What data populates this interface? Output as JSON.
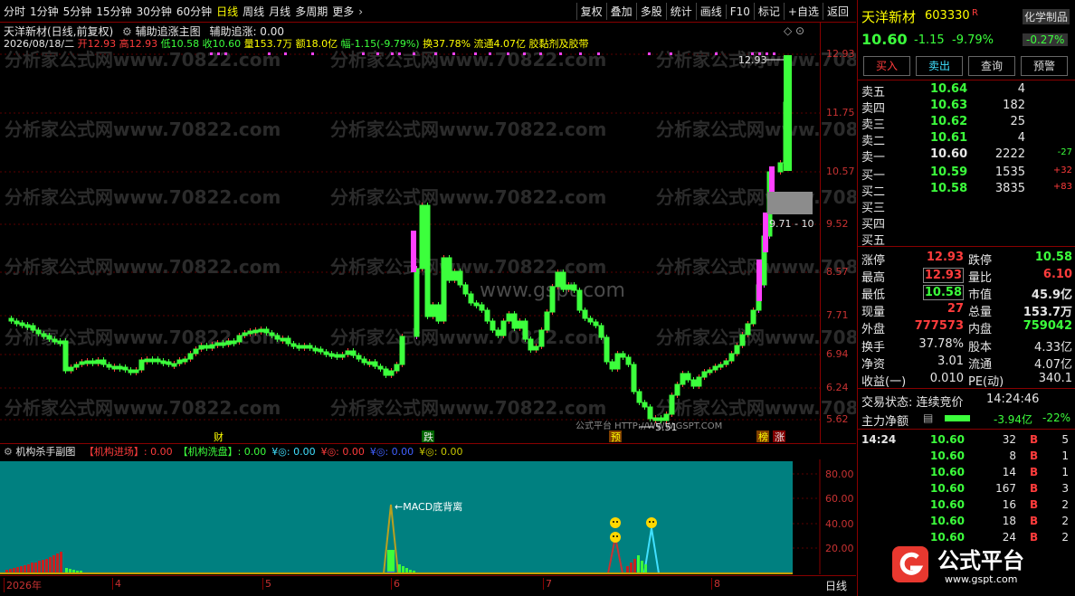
{
  "toolbar": {
    "periods": [
      "分时",
      "1分钟",
      "5分钟",
      "15分钟",
      "30分钟",
      "60分钟",
      "日线",
      "周线",
      "月线",
      "多周期",
      "更多"
    ],
    "active": "日线",
    "right": [
      "复权",
      "叠加",
      "多股",
      "统计",
      "画线",
      "F10",
      "标记",
      "+自选",
      "返回"
    ]
  },
  "header": {
    "title": "天洋新材(日线,前复权)",
    "indicator": "辅助追涨主图",
    "indicator_value": "辅助追涨: 0.00",
    "line2": {
      "date": "2026/08/18/二",
      "open": "开12.93",
      "high": "高12.93",
      "low": "低10.58",
      "close": "收10.60",
      "vol": "量153.7万",
      "amount": "额18.0亿",
      "change": "幅-1.15(-9.79%)",
      "turnover": "换37.78%",
      "float": "流通4.07亿",
      "sector": "胶黏剂及胶带"
    }
  },
  "yaxis": [
    "12.93",
    "11.75",
    "10.57",
    "9.52",
    "8.57",
    "7.71",
    "6.94",
    "6.24",
    "5.62"
  ],
  "annotations": {
    "high": "12.93",
    "band": "9.71 - 10",
    "low": "5.51",
    "watermark_center": "www.gspt.com",
    "watermark_small": "公式平台  HTTP://WWW.GSPT.COM",
    "watermark_rows": "分析家公式网www.70822.com",
    "markers": [
      "财",
      "跌",
      "预",
      "榜",
      "涨"
    ]
  },
  "sub": {
    "title": "机构杀手副图",
    "items": [
      {
        "label": "【机构进场】: 0.00",
        "color": "#ff3c3c"
      },
      {
        "label": "【机构洗盘】: 0.00",
        "color": "#3cff3c"
      },
      {
        "label": "¥◎: 0.00",
        "color": "#40e0ff"
      },
      {
        "label": "¥◎: 0.00",
        "color": "#ff3c3c"
      },
      {
        "label": "¥◎: 0.00",
        "color": "#4060ff"
      },
      {
        "label": "¥◎: 0.00",
        "color": "#c8c800"
      }
    ],
    "yaxis": [
      "80.00",
      "60.00",
      "40.00",
      "20.00"
    ],
    "macd_label": "MACD底背离"
  },
  "xaxis": {
    "labels": [
      "2026年",
      "4",
      "5",
      "6",
      "7",
      "8"
    ],
    "period": "日线"
  },
  "panel": {
    "name": "天洋新材",
    "code": "603330",
    "flag": "R",
    "sector": "化学制品",
    "sector_change": "-0.27%",
    "price": "10.60",
    "change": "-1.15",
    "pct": "-9.79%",
    "buttons": [
      "买入",
      "卖出",
      "查询",
      "预警"
    ],
    "asks": [
      {
        "label": "卖五",
        "price": "10.64",
        "vol": "4",
        "diff": ""
      },
      {
        "label": "卖四",
        "price": "10.63",
        "vol": "182",
        "diff": ""
      },
      {
        "label": "卖三",
        "price": "10.62",
        "vol": "25",
        "diff": ""
      },
      {
        "label": "卖二",
        "price": "10.61",
        "vol": "4",
        "diff": ""
      },
      {
        "label": "卖一",
        "price": "10.60",
        "vol": "2222",
        "diff": "-27"
      }
    ],
    "bids": [
      {
        "label": "买一",
        "price": "10.59",
        "vol": "1535",
        "diff": "+32"
      },
      {
        "label": "买二",
        "price": "10.58",
        "vol": "3835",
        "diff": "+83"
      },
      {
        "label": "买三",
        "price": "",
        "vol": "",
        "diff": ""
      },
      {
        "label": "买四",
        "price": "",
        "vol": "",
        "diff": ""
      },
      {
        "label": "买五",
        "price": "",
        "vol": "",
        "diff": ""
      }
    ],
    "stats": [
      {
        "k1": "涨停",
        "v1": "12.93",
        "c1": "#ff3c3c",
        "k2": "跌停",
        "v2": "10.58",
        "c2": "#3cff3c"
      },
      {
        "k1": "最高",
        "v1": "12.93",
        "c1": "#ff3c3c",
        "k2": "量比",
        "v2": "6.10",
        "c2": "#ff3c3c"
      },
      {
        "k1": "最低",
        "v1": "10.58",
        "c1": "#3cff3c",
        "k2": "市值",
        "v2": "45.9亿",
        "c2": "#e6e6e6"
      },
      {
        "k1": "现量",
        "v1": "27",
        "c1": "#ff3c3c",
        "k2": "总量",
        "v2": "153.7万",
        "c2": "#e6e6e6"
      },
      {
        "k1": "外盘",
        "v1": "777573",
        "c1": "#ff3c3c",
        "k2": "内盘",
        "v2": "759042",
        "c2": "#3cff3c"
      }
    ],
    "stats2": [
      {
        "k1": "换手",
        "v1": "37.78%",
        "k2": "股本",
        "v2": "4.33亿"
      },
      {
        "k1": "净资",
        "v1": "3.01",
        "k2": "流通",
        "v2": "4.07亿"
      },
      {
        "k1": "收益(一)",
        "v1": "0.010",
        "k2": "PE(动)",
        "v2": "340.1"
      }
    ],
    "trade_state": "交易状态: 连续竞价",
    "trade_time": "14:24:46",
    "net_label": "主力净额",
    "net_value": "-3.94亿",
    "net_pct": "-22%",
    "ticks": [
      {
        "t": "14:24",
        "p": "10.60",
        "v": "32",
        "s": "B",
        "n": "5"
      },
      {
        "t": "",
        "p": "10.60",
        "v": "8",
        "s": "B",
        "n": "1"
      },
      {
        "t": "",
        "p": "10.60",
        "v": "14",
        "s": "B",
        "n": "1"
      },
      {
        "t": "",
        "p": "10.60",
        "v": "167",
        "s": "B",
        "n": "3"
      },
      {
        "t": "",
        "p": "10.60",
        "v": "16",
        "s": "B",
        "n": "2"
      },
      {
        "t": "",
        "p": "10.60",
        "v": "18",
        "s": "B",
        "n": "2"
      },
      {
        "t": "",
        "p": "10.60",
        "v": "24",
        "s": "B",
        "n": "2"
      }
    ],
    "logo_text": "公式平台",
    "logo_url": "www.gspt.com"
  },
  "colors": {
    "up": "#ff3c3c",
    "down": "#3cff3c",
    "limit": "#ff40ff",
    "bg_sub": "#008080"
  }
}
